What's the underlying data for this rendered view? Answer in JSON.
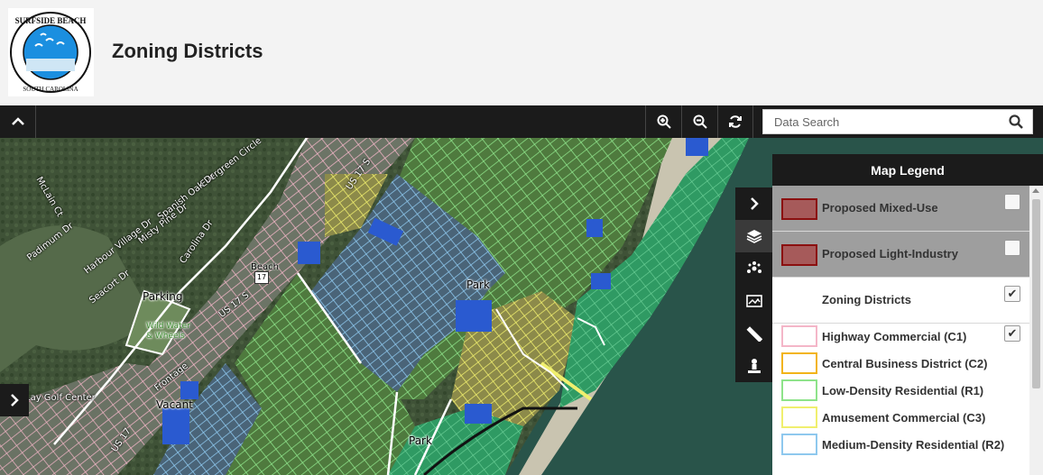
{
  "header": {
    "logo_text_top": "SURFSIDE BEACH",
    "logo_text_bottom": "SOUTH CAROLINA",
    "title": "Zoning Districts"
  },
  "toolbar": {
    "search_placeholder": "Data Search",
    "buttons": [
      "collapse-header",
      "zoom-in",
      "zoom-out",
      "refresh"
    ]
  },
  "map": {
    "street_labels": [
      "Evergreen Circle",
      "Spanish Oak Dr",
      "Misty Pine Dr",
      "Carolina Dr",
      "Harbour Village Dr",
      "Padimum Dr",
      "McLain Ct",
      "Seacort Dr",
      "US 17 S",
      "US 17 S",
      "US 17",
      "Frontage",
      "Lay Golf Center",
      "Beach"
    ],
    "pois": [
      "Parking",
      "Park",
      "Park",
      "Vacant",
      "Wild Water & Wheels"
    ],
    "route_shield": "17"
  },
  "side_rail": {
    "tools": [
      "collapse-panel",
      "layers",
      "networks",
      "basemap",
      "measure",
      "user-location"
    ]
  },
  "legend": {
    "title": "Map Legend",
    "overlays": [
      {
        "label": "Proposed Mixed-Use",
        "checked": false
      },
      {
        "label": "Proposed Light-Industry",
        "checked": false
      },
      {
        "label": "Zoning Districts",
        "checked": true
      }
    ],
    "zones": [
      {
        "label": "Highway Commercial (C1)",
        "color": "#f4b6c8",
        "checked": true
      },
      {
        "label": "Central Business District (C2)",
        "color": "#f2b418"
      },
      {
        "label": "Low-Density Residential (R1)",
        "color": "#8ee38a"
      },
      {
        "label": "Amusement Commercial (C3)",
        "color": "#f0ef6e"
      },
      {
        "label": "Medium-Density Residential (R2)",
        "color": "#8ec8ee"
      }
    ],
    "check_mark": "✔"
  },
  "colors": {
    "toolbar": "#1b1b1b",
    "proposed_fill": "#a65a5a",
    "proposed_border": "#8b1010"
  }
}
